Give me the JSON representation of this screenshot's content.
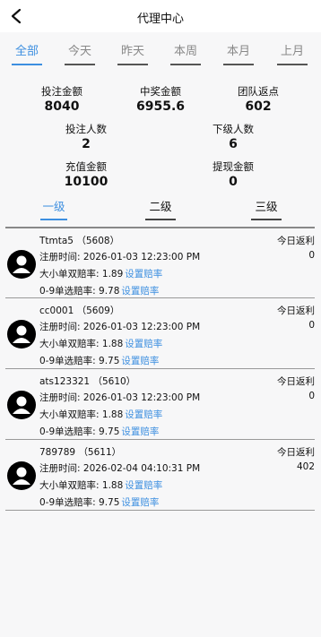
{
  "header": {
    "title": "代理中心"
  },
  "period_tabs": [
    "全部",
    "今天",
    "昨天",
    "本周",
    "本月",
    "上月"
  ],
  "stats": {
    "bet_amount": {
      "label": "投注金额",
      "value": "8040"
    },
    "win_amount": {
      "label": "中奖金额",
      "value": "6955.6"
    },
    "team_rebate": {
      "label": "团队返点",
      "value": "602"
    },
    "bettors": {
      "label": "投注人数",
      "value": "2"
    },
    "subordinates": {
      "label": "下级人数",
      "value": "6"
    },
    "deposit": {
      "label": "充值金额",
      "value": "10100"
    },
    "withdraw": {
      "label": "提现金额",
      "value": "0"
    }
  },
  "level_tabs": [
    "一级",
    "二级",
    "三级"
  ],
  "members": [
    {
      "name": "Ttmta5",
      "id": "（5608）",
      "reg_label": "注册时间:",
      "reg_time": "2026-01-03 12:23:00 PM",
      "odds1_label": "大小单双赔率:",
      "odds1": "1.89",
      "odds1_link": "设置赔率",
      "odds2_label": "0-9单选赔率:",
      "odds2": "9.78",
      "odds2_link": "设置赔率",
      "rebate_label": "今日返利",
      "rebate": "0"
    },
    {
      "name": "cc0001",
      "id": "（5609）",
      "reg_label": "注册时间:",
      "reg_time": "2026-01-03 12:23:00 PM",
      "odds1_label": "大小单双赔率:",
      "odds1": "1.88",
      "odds1_link": "设置赔率",
      "odds2_label": "0-9单选赔率:",
      "odds2": "9.75",
      "odds2_link": "设置赔率",
      "rebate_label": "今日返利",
      "rebate": "0"
    },
    {
      "name": "ats123321",
      "id": "（5610）",
      "reg_label": "注册时间:",
      "reg_time": "2026-01-03 12:23:00 PM",
      "odds1_label": "大小单双赔率:",
      "odds1": "1.88",
      "odds1_link": "设置赔率",
      "odds2_label": "0-9单选赔率:",
      "odds2": "9.75",
      "odds2_link": "设置赔率",
      "rebate_label": "今日返利",
      "rebate": "0"
    },
    {
      "name": "789789",
      "id": "（5611）",
      "reg_label": "注册时间:",
      "reg_time": "2026-02-04 04:10:31 PM",
      "odds1_label": "大小单双赔率:",
      "odds1": "1.88",
      "odds1_link": "设置赔率",
      "odds2_label": "0-9单选赔率:",
      "odds2": "9.75",
      "odds2_link": "设置赔率",
      "rebate_label": "今日返利",
      "rebate": "402"
    }
  ],
  "icons": {
    "back": "chevron-left-icon",
    "avatar": "user-avatar-icon"
  },
  "colors": {
    "accent": "#3d8fe0",
    "background": "#f7f7f8"
  }
}
